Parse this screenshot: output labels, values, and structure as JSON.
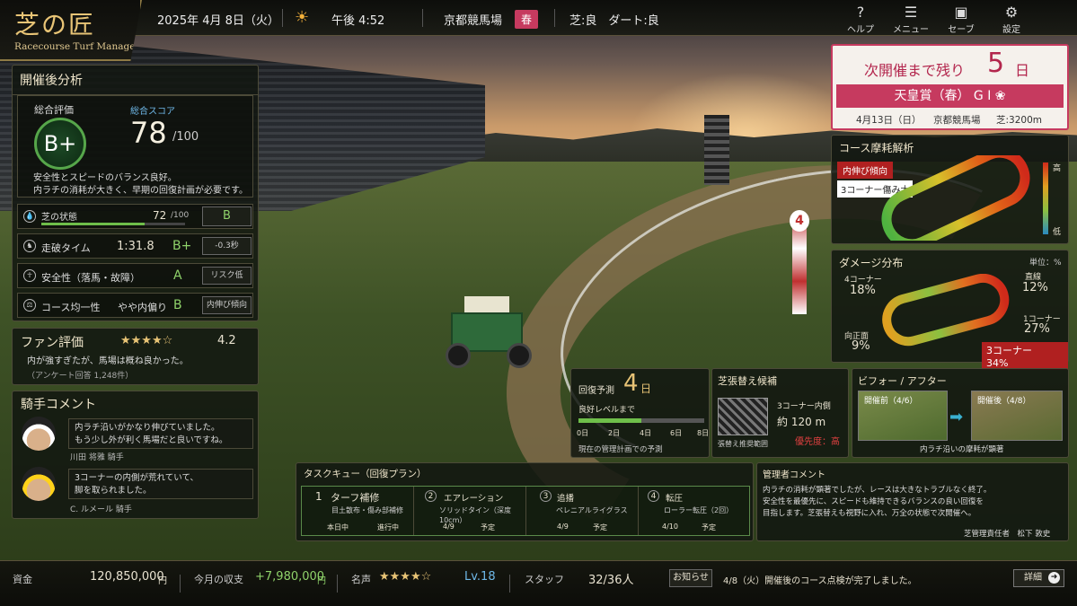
{
  "header": {
    "logo_kanji": "芝の匠",
    "logo_en": "Racecourse Turf Manager",
    "date": "2025年 4月 8日（火）",
    "time": "午後 4:52",
    "racecourse": "京都競馬場",
    "season": "春",
    "conditions": "芝:良　ダート:良",
    "tools": [
      {
        "icon": "help-icon",
        "label": "ヘルプ",
        "glyph": "?"
      },
      {
        "icon": "menu-icon",
        "label": "メニュー",
        "glyph": "☰"
      },
      {
        "icon": "save-icon",
        "label": "セーブ",
        "glyph": "▣"
      },
      {
        "icon": "settings-icon",
        "label": "設定",
        "glyph": "⚙"
      }
    ]
  },
  "analysis": {
    "title": "開催後分析",
    "overall_label": "総合評価",
    "grade": "B+",
    "score_label": "総合スコア",
    "score": "78",
    "score_max": "/100",
    "desc1": "安全性とスピードのバランス良好。",
    "desc2": "内ラチの消耗が大きく、早期の回復計画が必要です。",
    "turf_label": "芝の状態",
    "turf_value": "72",
    "turf_max": "/100",
    "turf_level": 0.72,
    "turf_grade": "B",
    "time_label": "走破タイム",
    "time_value": "1:31.8",
    "time_grade": "B+",
    "time_delta": "-0.3秒",
    "safety_label": "安全性（落馬・故障）",
    "safety_grade": "A",
    "safety_chip": "リスク低",
    "uniform_label": "コース均一性",
    "uniform_value": "やや内偏り",
    "uniform_grade": "B",
    "uniform_chip": "内伸び傾向"
  },
  "fan": {
    "title": "ファン評価",
    "stars": "★★★★☆",
    "rating": "4.2",
    "comment": "内が強すぎたが、馬場は概ね良かった。",
    "responses": "（アンケート回答 1,248件）"
  },
  "jockeys": {
    "title": "騎手コメント",
    "items": [
      {
        "text1": "内ラチ沿いがかなり伸びていました。",
        "text2": "もう少し外が利く馬場だと良いですね。",
        "name": "川田 将雅 騎手"
      },
      {
        "text1": "3コーナーの内側が荒れていて、",
        "text2": "脚を取られました。",
        "name": "C. ルメール 騎手"
      }
    ]
  },
  "next_race": {
    "prefix": "次開催まで残り",
    "days": "5",
    "suffix": "日",
    "race": "天皇賞（春） G Ⅰ",
    "date": "4月13日（日）",
    "venue": "京都競馬場",
    "distance": "芝:3200m"
  },
  "wear": {
    "title": "コース摩耗解析",
    "tag1": "内伸び傾向",
    "tag2": "3コーナー傷み大",
    "high": "高",
    "low": "低"
  },
  "damage": {
    "title": "ダメージ分布",
    "unit": "単位：%",
    "c4_label": "4コーナー",
    "c4": "18%",
    "straight_label": "直線",
    "straight": "12%",
    "front_label": "向正面",
    "front": "9%",
    "c1_label": "1コーナー",
    "c1": "27%",
    "c3": "3コーナー　34%"
  },
  "recovery": {
    "title": "回復予測",
    "days": "4",
    "unit": "日",
    "sub": "良好レベルまで",
    "ticks": [
      "0日",
      "2日",
      "4日",
      "6日",
      "8日"
    ],
    "progress": 0.5,
    "note": "現在の管理計画での予測"
  },
  "resod": {
    "title": "芝張替え候補",
    "area": "3コーナー内側",
    "size": "約 120 m",
    "caption": "張替え推奨範囲",
    "priority": "優先度：高"
  },
  "beforeafter": {
    "title": "ビフォー / アフター",
    "before": "開催前（4/6）",
    "after": "開催後（4/8）",
    "caption": "内ラチ沿いの摩耗が顕著"
  },
  "tasks": {
    "title": "タスクキュー（回復プラン）",
    "items": [
      {
        "no": "1",
        "name": "ターフ補修",
        "detail": "目土散布・傷み部補修",
        "when": "本日中",
        "status": "進行中"
      },
      {
        "no": "2",
        "name": "エアレーション",
        "detail": "ソリッドタイン（深度10cm）",
        "when": "4/9",
        "status": "予定"
      },
      {
        "no": "3",
        "name": "追播",
        "detail": "ペレニアルライグラス",
        "when": "4/9",
        "status": "予定"
      },
      {
        "no": "4",
        "name": "転圧",
        "detail": "ローラー転圧（2回）",
        "when": "4/10",
        "status": "予定"
      }
    ]
  },
  "manager": {
    "title": "管理者コメント",
    "line1": "内ラチの消耗が顕著でしたが、レースは大きなトラブルなく終了。",
    "line2": "安全性を最優先に、スピードも維持できるバランスの良い回復を",
    "line3": "目指します。芝張替えも視野に入れ、万全の状態で次開催へ。",
    "signature": "芝管理責任者　松下 敦史"
  },
  "footer": {
    "funds_label": "資金",
    "funds": "120,850,000",
    "funds_unit": "円",
    "income_label": "今月の収支",
    "income": "+7,980,000",
    "income_unit": "円",
    "fame_label": "名声",
    "fame_stars": "★★★★☆",
    "level": "Lv.18",
    "staff_label": "スタッフ",
    "staff": "32/36人",
    "notice_label": "お知らせ",
    "notice": "4/8（火）開催後のコース点検が完了しました。",
    "detail_button": "詳細"
  },
  "colors": {
    "accent": "#c63a5f",
    "gold": "#e8c476",
    "green": "#8fd26a",
    "red": "#e04040"
  }
}
